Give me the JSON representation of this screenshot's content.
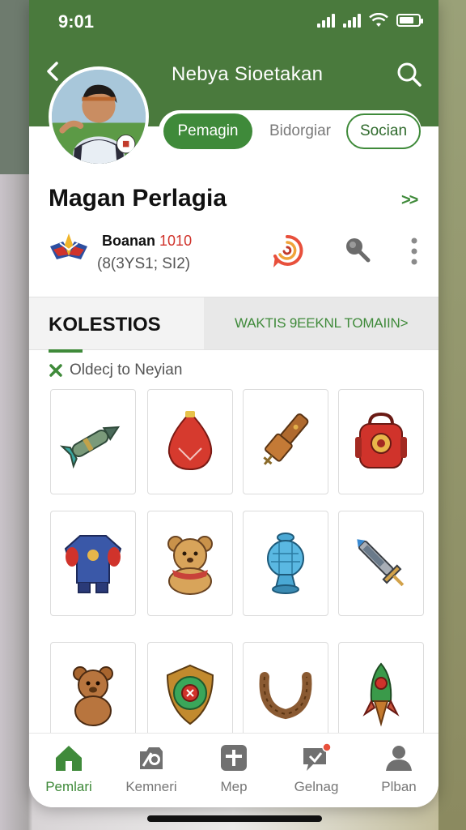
{
  "status": {
    "time": "9:01",
    "battery_level": 0.75
  },
  "header": {
    "title": "Nebya Sioetakan",
    "back_icon": "chevron-left-icon",
    "search_icon": "search-icon"
  },
  "tabs": [
    {
      "label": "Pemagin",
      "active": true
    },
    {
      "label": "Bidorgiar",
      "active": false
    },
    {
      "label": "Socian",
      "active": false
    }
  ],
  "profile": {
    "name": "Magan Perlagia",
    "more_label": ">>",
    "team_name": "Boanan",
    "team_number": "1010",
    "team_stats": "(8(3YS1; SI2)"
  },
  "section": {
    "title": "KOLESTIOS",
    "link": "WAKTIS 9EEKNL  TOMAIIN>"
  },
  "filter": {
    "label": "Oldecj to Neyian"
  },
  "collection": [
    {
      "name": "green-rocket-item"
    },
    {
      "name": "red-gem-item"
    },
    {
      "name": "wooden-bat-item"
    },
    {
      "name": "red-backpack-item"
    },
    {
      "name": "blue-jacket-item"
    },
    {
      "name": "teddy-bear-scarf-item"
    },
    {
      "name": "blue-vase-item"
    },
    {
      "name": "silver-syringe-item"
    },
    {
      "name": "brown-teddy-item"
    },
    {
      "name": "green-shield-item"
    },
    {
      "name": "rope-horseshoe-item"
    },
    {
      "name": "green-rocket-small-item"
    }
  ],
  "bottom_nav": [
    {
      "label": "Pemlari",
      "icon": "home-icon",
      "active": true
    },
    {
      "label": "Kemneri",
      "icon": "camera-icon",
      "active": false
    },
    {
      "label": "Mep",
      "icon": "plus-box-icon",
      "active": false
    },
    {
      "label": "Gelnag",
      "icon": "chat-icon",
      "active": false
    },
    {
      "label": "Plban",
      "icon": "person-icon",
      "active": false
    }
  ],
  "colors": {
    "brand_green": "#4a7a3d",
    "accent_green": "#3f8a3a",
    "red": "#d0332b"
  }
}
